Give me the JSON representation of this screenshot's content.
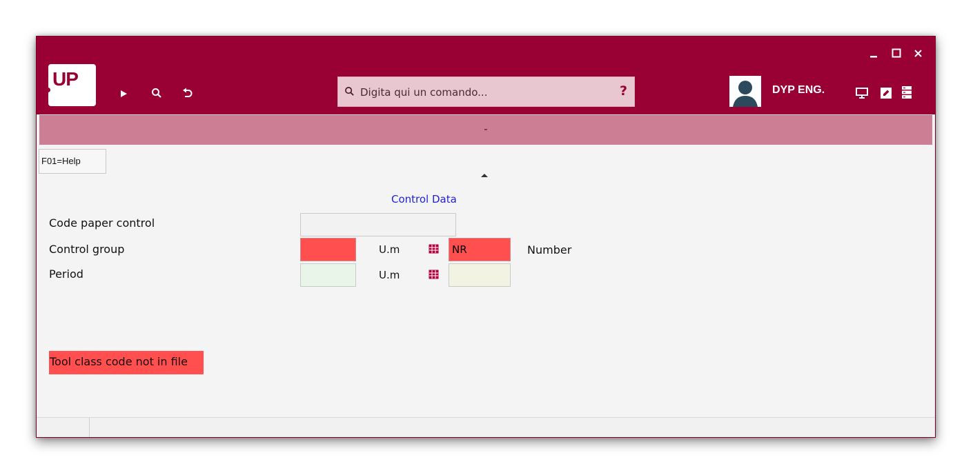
{
  "titlebar": {
    "logo_text": "UP",
    "user_name": "DYP ENG.",
    "colors": {
      "brand": "#990033",
      "subheader": "#cc7e94",
      "error": "#ff4f4f"
    }
  },
  "command": {
    "placeholder": "Digita qui un comando...",
    "help": "?"
  },
  "subheader": {
    "text": "-"
  },
  "toolbar": {
    "help_button": "F01=Help"
  },
  "form": {
    "section_title": "Control Data",
    "rows": [
      {
        "label": "Code paper control",
        "value": ""
      },
      {
        "label": "Control group",
        "value": "",
        "um_label": "U.m",
        "um_value": "NR",
        "um_description": "Number"
      },
      {
        "label": "Period",
        "value": "",
        "um_label": "U.m",
        "um_value": ""
      }
    ]
  },
  "error_message": "Tool class code not in file"
}
